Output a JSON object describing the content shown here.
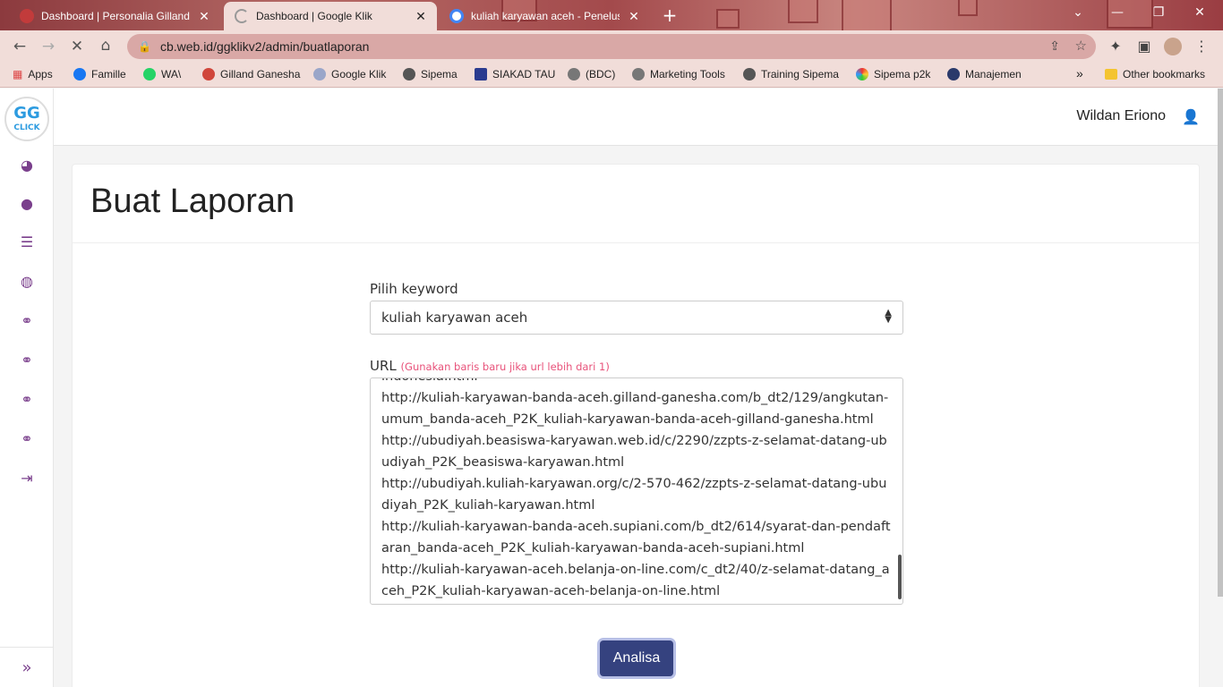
{
  "browser": {
    "tabs": [
      {
        "title": "Dashboard | Personalia Gilland G",
        "active": false
      },
      {
        "title": "Dashboard | Google Klik",
        "active": true
      },
      {
        "title": "kuliah karyawan aceh - Penelusur",
        "active": false
      }
    ],
    "new_tab": "+",
    "url": "cb.web.id/ggklikv2/admin/buatlaporan",
    "bookmarks": [
      {
        "label": "Apps",
        "icon": "apps-grid-icon"
      },
      {
        "label": "Famille",
        "icon": "facebook-icon"
      },
      {
        "label": "WA\\",
        "icon": "whatsapp-icon"
      },
      {
        "label": "Gilland Ganesha",
        "icon": "gilland-icon"
      },
      {
        "label": "Google Klik",
        "icon": "googleklik-icon"
      },
      {
        "label": "Sipema",
        "icon": "globe-icon"
      },
      {
        "label": "SIAKAD TAU",
        "icon": "shield-icon"
      },
      {
        "label": "(BDC)",
        "icon": "bdc-icon"
      },
      {
        "label": "Marketing Tools",
        "icon": "marketing-icon"
      },
      {
        "label": "Training Sipema",
        "icon": "globe-icon"
      },
      {
        "label": "Sipema p2k",
        "icon": "sipema-p2k-icon"
      },
      {
        "label": "Manajemen",
        "icon": "graduation-icon"
      }
    ],
    "bookmarks_more": "»",
    "other_bookmarks": "Other bookmarks"
  },
  "app": {
    "logo_top": "GG",
    "logo_bottom": "CLICK",
    "user_name": "Wildan Eriono",
    "page_title": "Buat Laporan",
    "keyword_label": "Pilih keyword",
    "keyword_value": "kuliah karyawan aceh",
    "url_label": "URL",
    "url_hint": "(Gunakan baris baru jika url lebih dari 1)",
    "url_value": "indonesia.html\nhttp://kuliah-karyawan-banda-aceh.gilland-ganesha.com/b_dt2/129/angkutan-umum_banda-aceh_P2K_kuliah-karyawan-banda-aceh-gilland-ganesha.html\nhttp://ubudiyah.beasiswa-karyawan.web.id/c/2290/zzpts-z-selamat-datang-ubudiyah_P2K_beasiswa-karyawan.html\nhttp://ubudiyah.kuliah-karyawan.org/c/2-570-462/zzpts-z-selamat-datang-ubudiyah_P2K_kuliah-karyawan.html\nhttp://kuliah-karyawan-banda-aceh.supiani.com/b_dt2/614/syarat-dan-pendaftaran_banda-aceh_P2K_kuliah-karyawan-banda-aceh-supiani.html\nhttp://kuliah-karyawan-aceh.belanja-on-line.com/c_dt2/40/z-selamat-datang_aceh_P2K_kuliah-karyawan-aceh-belanja-on-line.html",
    "submit_label": "Analisa"
  },
  "colors": {
    "accent": "#35427f",
    "sidebar_icon": "#7a3f8c",
    "hint": "#e8527a"
  }
}
